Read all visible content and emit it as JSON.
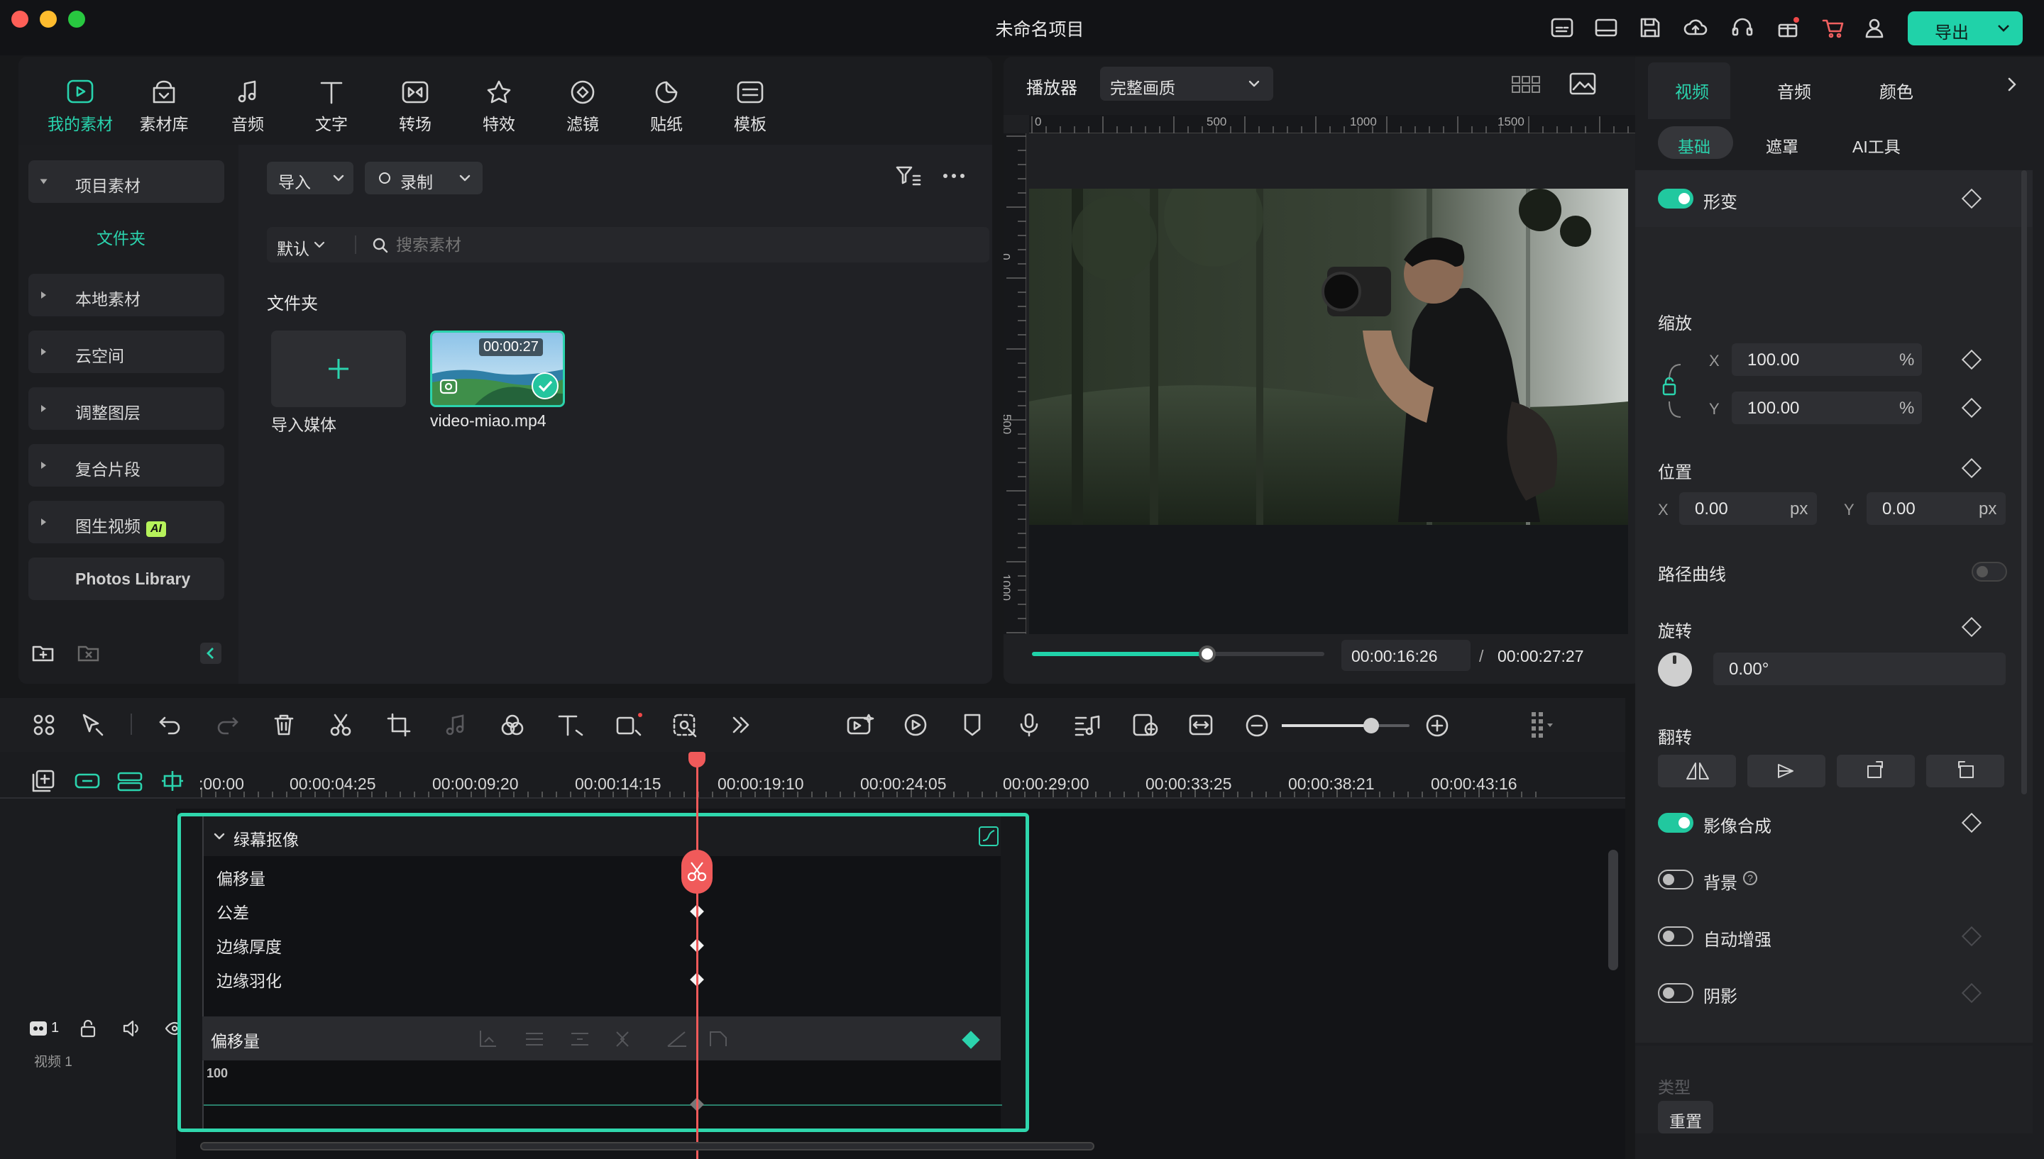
{
  "app": {
    "title": "未命名项目",
    "export_label": "导出"
  },
  "colors": {
    "accent": "#20d2a9",
    "playhead": "#f05a5a",
    "bg": "#17181a"
  },
  "titlebar_icons": [
    "subtitle-icon",
    "layout-icon",
    "save-icon",
    "cloud-upload-icon",
    "headset-icon",
    "gift-icon",
    "cart-icon",
    "user-icon"
  ],
  "media_tabs": [
    {
      "label": "我的素材",
      "icon": "my-media-icon",
      "active": true
    },
    {
      "label": "素材库",
      "icon": "stock-library-icon"
    },
    {
      "label": "音频",
      "icon": "music-note-icon"
    },
    {
      "label": "文字",
      "icon": "text-icon"
    },
    {
      "label": "转场",
      "icon": "transition-icon"
    },
    {
      "label": "特效",
      "icon": "effects-icon"
    },
    {
      "label": "滤镜",
      "icon": "filter-icon"
    },
    {
      "label": "贴纸",
      "icon": "sticker-icon"
    },
    {
      "label": "模板",
      "icon": "template-icon"
    }
  ],
  "sidebar": {
    "project_media": "项目素材",
    "folder": "文件夹",
    "items": [
      "本地素材",
      "云空间",
      "调整图层",
      "复合片段",
      "图生视频"
    ],
    "ai_badge": "AI",
    "photos_library": "Photos Library"
  },
  "media_toolbar": {
    "import_label": "导入",
    "record_label": "录制",
    "sort_label": "默认",
    "search_placeholder": "搜索素材"
  },
  "media_content": {
    "folder_heading": "文件夹",
    "import_media_label": "导入媒体",
    "clip": {
      "name": "video-miao.mp4",
      "duration": "00:00:27"
    }
  },
  "player": {
    "label": "播放器",
    "quality": "完整画质",
    "ruler_h": [
      "0",
      "500",
      "1000",
      "1500"
    ],
    "ruler_v": [
      "0",
      "500",
      "1000"
    ],
    "current_time": "00:00:16:26",
    "separator": "/",
    "total_time": "00:00:27:27",
    "progress": 0.6
  },
  "inspector": {
    "tabs": [
      "视频",
      "音频",
      "颜色"
    ],
    "subtabs": [
      "基础",
      "遮罩",
      "AI工具"
    ],
    "transform": "形变",
    "scale": {
      "label": "缩放",
      "x_label": "X",
      "x_value": "100.00",
      "y_label": "Y",
      "y_value": "100.00",
      "unit": "%"
    },
    "position": {
      "label": "位置",
      "x_label": "X",
      "x_value": "0.00",
      "y_label": "Y",
      "y_value": "0.00",
      "unit": "px"
    },
    "path_curve": "路径曲线",
    "rotation": {
      "label": "旋转",
      "value": "0.00°"
    },
    "flip": "翻转",
    "composite": "影像合成",
    "background": "背景",
    "auto_enhance": "自动增强",
    "shadow": "阴影",
    "type_label": "类型",
    "reset": "重置"
  },
  "timeline": {
    "ruler": ":00:00|00:00:04:25|00:00:09:20|00:00:14:15|00:00:19:10|00:00:24:05|00:00:29:00|00:00:33:25|00:00:38:21|00:00:43:16",
    "zoom": 0.7,
    "track_label": "视频 1",
    "track_number": "1",
    "effect_title": "绿幕抠像",
    "properties": [
      "偏移量",
      "公差",
      "边缘厚度",
      "边缘羽化"
    ],
    "graph_label": "偏移量",
    "graph_value": "100"
  }
}
